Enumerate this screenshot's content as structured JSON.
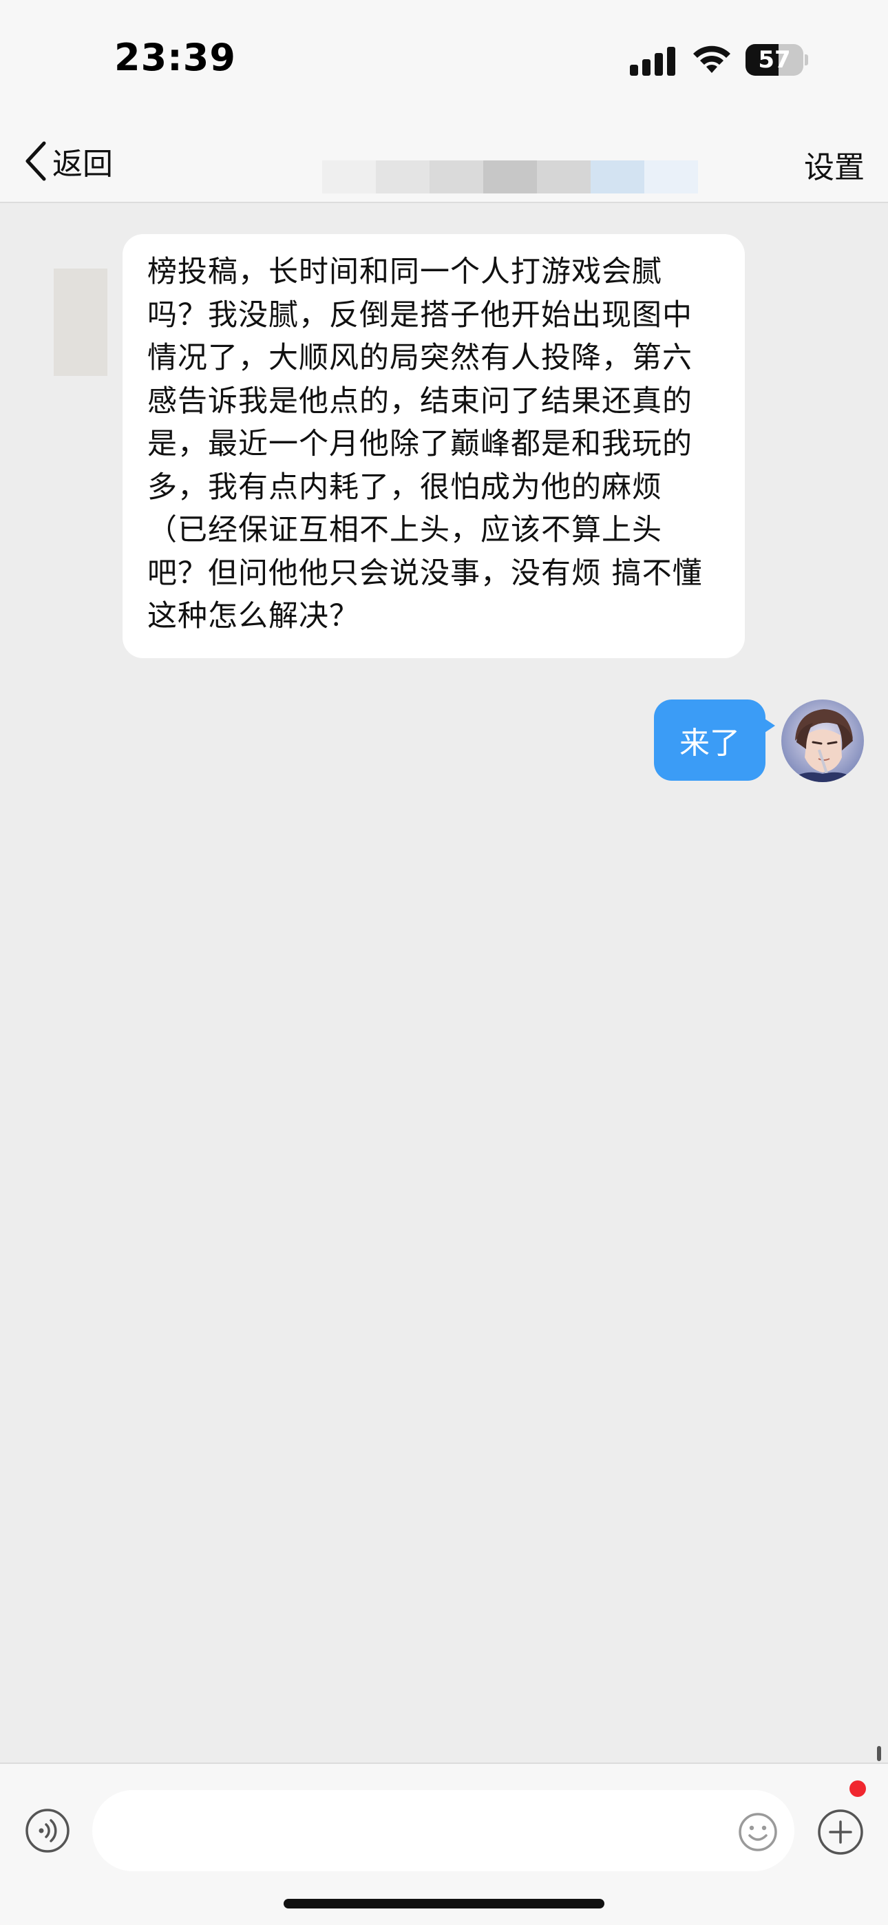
{
  "status_bar": {
    "time": "23:39",
    "battery_level": 57,
    "battery_label": "57",
    "icons": [
      "cellular-signal-icon",
      "wifi-icon",
      "battery-icon"
    ]
  },
  "nav": {
    "back_label": "返回",
    "settings_label": "设置",
    "title_blurred_colors": [
      "#efefef",
      "#e4e4e4",
      "#dadada",
      "#c7c7c7",
      "#d6d6d6",
      "#d3e3f2",
      "#eaf1f9"
    ]
  },
  "messages": [
    {
      "side": "left",
      "text": "榜投稿，长时间和同一个人打游戏会腻吗？我没腻，反倒是搭子他开始出现图中情况了，大顺风的局突然有人投降，第六感告诉我是他点的，结束问了结果还真的是，最近一个月他除了巅峰都是和我玩的多，我有点内耗了，很怕成为他的麻烦（已经保证互相不上头，应该不算上头吧？但问他他只会说没事，没有烦 搞不懂这种怎么解决？"
    },
    {
      "side": "right",
      "text": "来了"
    }
  ],
  "input_bar": {
    "placeholder": "",
    "icons": [
      "voice-icon",
      "emoji-icon",
      "plus-icon"
    ],
    "notification_dot_color": "#f0272f"
  },
  "colors": {
    "accent_bubble": "#3b9cf6",
    "background": "#ededed",
    "bar_background": "#f7f7f7"
  }
}
